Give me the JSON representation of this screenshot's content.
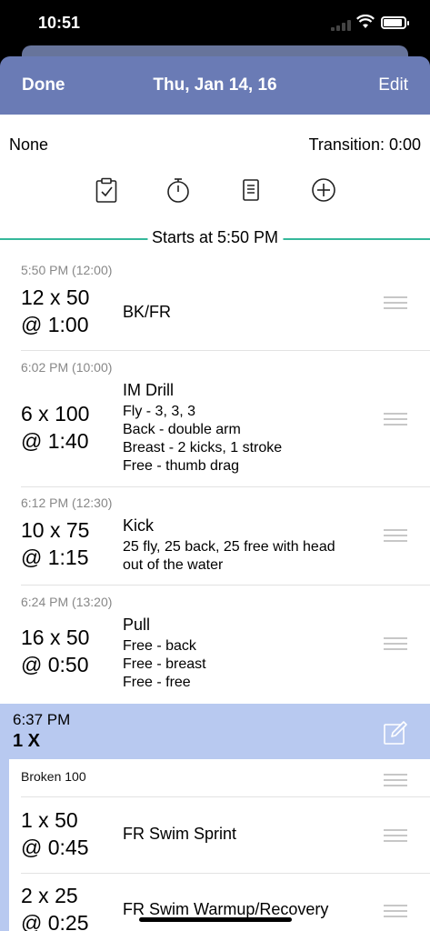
{
  "status": {
    "time": "10:51"
  },
  "nav": {
    "done": "Done",
    "title": "Thu, Jan 14, 16",
    "edit": "Edit"
  },
  "info": {
    "left": "None",
    "right": "Transition: 0:00"
  },
  "toolbar": {
    "icons": [
      "clipboard-check-icon",
      "stopwatch-icon",
      "note-icon",
      "add-circle-icon"
    ]
  },
  "starts": "Starts at 5:50 PM",
  "sets": [
    {
      "time": "5:50 PM (12:00)",
      "reps": "12 x 50",
      "interval": "@ 1:00",
      "title": "BK/FR",
      "lines": []
    },
    {
      "time": "6:02 PM (10:00)",
      "reps": "6 x 100",
      "interval": "@ 1:40",
      "title": "IM Drill",
      "lines": [
        "Fly - 3, 3, 3",
        "Back - double arm",
        "Breast - 2 kicks, 1 stroke",
        "Free - thumb drag"
      ]
    },
    {
      "time": "6:12 PM (12:30)",
      "reps": "10 x 75",
      "interval": "@ 1:15",
      "title": "Kick",
      "lines": [
        "25 fly, 25 back, 25 free with head",
        "out of the water"
      ]
    },
    {
      "time": "6:24 PM (13:20)",
      "reps": "16 x 50",
      "interval": "@ 0:50",
      "title": "Pull",
      "lines": [
        "Free - back",
        "Free - breast",
        "Free - free"
      ]
    }
  ],
  "group": {
    "time": "6:37 PM",
    "count": "1 X",
    "name": "Broken 100",
    "sets": [
      {
        "reps": "1 x 50",
        "interval": "@ 0:45",
        "title": "FR Swim Sprint"
      },
      {
        "reps": "2 x 25",
        "interval": "@ 0:25",
        "title": "FR Swim Warmup/Recovery"
      }
    ]
  },
  "colors": {
    "nav": "#6a7bb5",
    "group": "#b8c9f0",
    "accent": "#35b89b"
  }
}
